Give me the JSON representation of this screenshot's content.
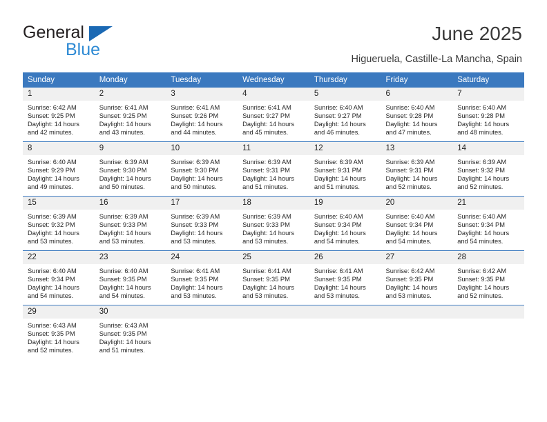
{
  "brand": {
    "name_part1": "General",
    "name_part2": "Blue",
    "triangle_color": "#1b69b4",
    "blue_text_color": "#2e8ad4"
  },
  "header": {
    "title": "June 2025",
    "location": "Higueruela, Castille-La Mancha, Spain"
  },
  "theme": {
    "header_blue": "#3b79bf",
    "daynum_band": "#f0f0f0",
    "text": "#262626"
  },
  "weekdays": [
    "Sunday",
    "Monday",
    "Tuesday",
    "Wednesday",
    "Thursday",
    "Friday",
    "Saturday"
  ],
  "labels": {
    "sunrise": "Sunrise:",
    "sunset": "Sunset:",
    "daylight": "Daylight:"
  },
  "days": [
    {
      "n": "1",
      "sunrise": "Sunrise: 6:42 AM",
      "sunset": "Sunset: 9:25 PM",
      "daylight1": "Daylight: 14 hours",
      "daylight2": "and 42 minutes."
    },
    {
      "n": "2",
      "sunrise": "Sunrise: 6:41 AM",
      "sunset": "Sunset: 9:25 PM",
      "daylight1": "Daylight: 14 hours",
      "daylight2": "and 43 minutes."
    },
    {
      "n": "3",
      "sunrise": "Sunrise: 6:41 AM",
      "sunset": "Sunset: 9:26 PM",
      "daylight1": "Daylight: 14 hours",
      "daylight2": "and 44 minutes."
    },
    {
      "n": "4",
      "sunrise": "Sunrise: 6:41 AM",
      "sunset": "Sunset: 9:27 PM",
      "daylight1": "Daylight: 14 hours",
      "daylight2": "and 45 minutes."
    },
    {
      "n": "5",
      "sunrise": "Sunrise: 6:40 AM",
      "sunset": "Sunset: 9:27 PM",
      "daylight1": "Daylight: 14 hours",
      "daylight2": "and 46 minutes."
    },
    {
      "n": "6",
      "sunrise": "Sunrise: 6:40 AM",
      "sunset": "Sunset: 9:28 PM",
      "daylight1": "Daylight: 14 hours",
      "daylight2": "and 47 minutes."
    },
    {
      "n": "7",
      "sunrise": "Sunrise: 6:40 AM",
      "sunset": "Sunset: 9:28 PM",
      "daylight1": "Daylight: 14 hours",
      "daylight2": "and 48 minutes."
    },
    {
      "n": "8",
      "sunrise": "Sunrise: 6:40 AM",
      "sunset": "Sunset: 9:29 PM",
      "daylight1": "Daylight: 14 hours",
      "daylight2": "and 49 minutes."
    },
    {
      "n": "9",
      "sunrise": "Sunrise: 6:39 AM",
      "sunset": "Sunset: 9:30 PM",
      "daylight1": "Daylight: 14 hours",
      "daylight2": "and 50 minutes."
    },
    {
      "n": "10",
      "sunrise": "Sunrise: 6:39 AM",
      "sunset": "Sunset: 9:30 PM",
      "daylight1": "Daylight: 14 hours",
      "daylight2": "and 50 minutes."
    },
    {
      "n": "11",
      "sunrise": "Sunrise: 6:39 AM",
      "sunset": "Sunset: 9:31 PM",
      "daylight1": "Daylight: 14 hours",
      "daylight2": "and 51 minutes."
    },
    {
      "n": "12",
      "sunrise": "Sunrise: 6:39 AM",
      "sunset": "Sunset: 9:31 PM",
      "daylight1": "Daylight: 14 hours",
      "daylight2": "and 51 minutes."
    },
    {
      "n": "13",
      "sunrise": "Sunrise: 6:39 AM",
      "sunset": "Sunset: 9:31 PM",
      "daylight1": "Daylight: 14 hours",
      "daylight2": "and 52 minutes."
    },
    {
      "n": "14",
      "sunrise": "Sunrise: 6:39 AM",
      "sunset": "Sunset: 9:32 PM",
      "daylight1": "Daylight: 14 hours",
      "daylight2": "and 52 minutes."
    },
    {
      "n": "15",
      "sunrise": "Sunrise: 6:39 AM",
      "sunset": "Sunset: 9:32 PM",
      "daylight1": "Daylight: 14 hours",
      "daylight2": "and 53 minutes."
    },
    {
      "n": "16",
      "sunrise": "Sunrise: 6:39 AM",
      "sunset": "Sunset: 9:33 PM",
      "daylight1": "Daylight: 14 hours",
      "daylight2": "and 53 minutes."
    },
    {
      "n": "17",
      "sunrise": "Sunrise: 6:39 AM",
      "sunset": "Sunset: 9:33 PM",
      "daylight1": "Daylight: 14 hours",
      "daylight2": "and 53 minutes."
    },
    {
      "n": "18",
      "sunrise": "Sunrise: 6:39 AM",
      "sunset": "Sunset: 9:33 PM",
      "daylight1": "Daylight: 14 hours",
      "daylight2": "and 53 minutes."
    },
    {
      "n": "19",
      "sunrise": "Sunrise: 6:40 AM",
      "sunset": "Sunset: 9:34 PM",
      "daylight1": "Daylight: 14 hours",
      "daylight2": "and 54 minutes."
    },
    {
      "n": "20",
      "sunrise": "Sunrise: 6:40 AM",
      "sunset": "Sunset: 9:34 PM",
      "daylight1": "Daylight: 14 hours",
      "daylight2": "and 54 minutes."
    },
    {
      "n": "21",
      "sunrise": "Sunrise: 6:40 AM",
      "sunset": "Sunset: 9:34 PM",
      "daylight1": "Daylight: 14 hours",
      "daylight2": "and 54 minutes."
    },
    {
      "n": "22",
      "sunrise": "Sunrise: 6:40 AM",
      "sunset": "Sunset: 9:34 PM",
      "daylight1": "Daylight: 14 hours",
      "daylight2": "and 54 minutes."
    },
    {
      "n": "23",
      "sunrise": "Sunrise: 6:40 AM",
      "sunset": "Sunset: 9:35 PM",
      "daylight1": "Daylight: 14 hours",
      "daylight2": "and 54 minutes."
    },
    {
      "n": "24",
      "sunrise": "Sunrise: 6:41 AM",
      "sunset": "Sunset: 9:35 PM",
      "daylight1": "Daylight: 14 hours",
      "daylight2": "and 53 minutes."
    },
    {
      "n": "25",
      "sunrise": "Sunrise: 6:41 AM",
      "sunset": "Sunset: 9:35 PM",
      "daylight1": "Daylight: 14 hours",
      "daylight2": "and 53 minutes."
    },
    {
      "n": "26",
      "sunrise": "Sunrise: 6:41 AM",
      "sunset": "Sunset: 9:35 PM",
      "daylight1": "Daylight: 14 hours",
      "daylight2": "and 53 minutes."
    },
    {
      "n": "27",
      "sunrise": "Sunrise: 6:42 AM",
      "sunset": "Sunset: 9:35 PM",
      "daylight1": "Daylight: 14 hours",
      "daylight2": "and 53 minutes."
    },
    {
      "n": "28",
      "sunrise": "Sunrise: 6:42 AM",
      "sunset": "Sunset: 9:35 PM",
      "daylight1": "Daylight: 14 hours",
      "daylight2": "and 52 minutes."
    },
    {
      "n": "29",
      "sunrise": "Sunrise: 6:43 AM",
      "sunset": "Sunset: 9:35 PM",
      "daylight1": "Daylight: 14 hours",
      "daylight2": "and 52 minutes."
    },
    {
      "n": "30",
      "sunrise": "Sunrise: 6:43 AM",
      "sunset": "Sunset: 9:35 PM",
      "daylight1": "Daylight: 14 hours",
      "daylight2": "and 51 minutes."
    }
  ],
  "grid": {
    "leading_blanks": 0,
    "weeks": 5,
    "columns": 7
  }
}
